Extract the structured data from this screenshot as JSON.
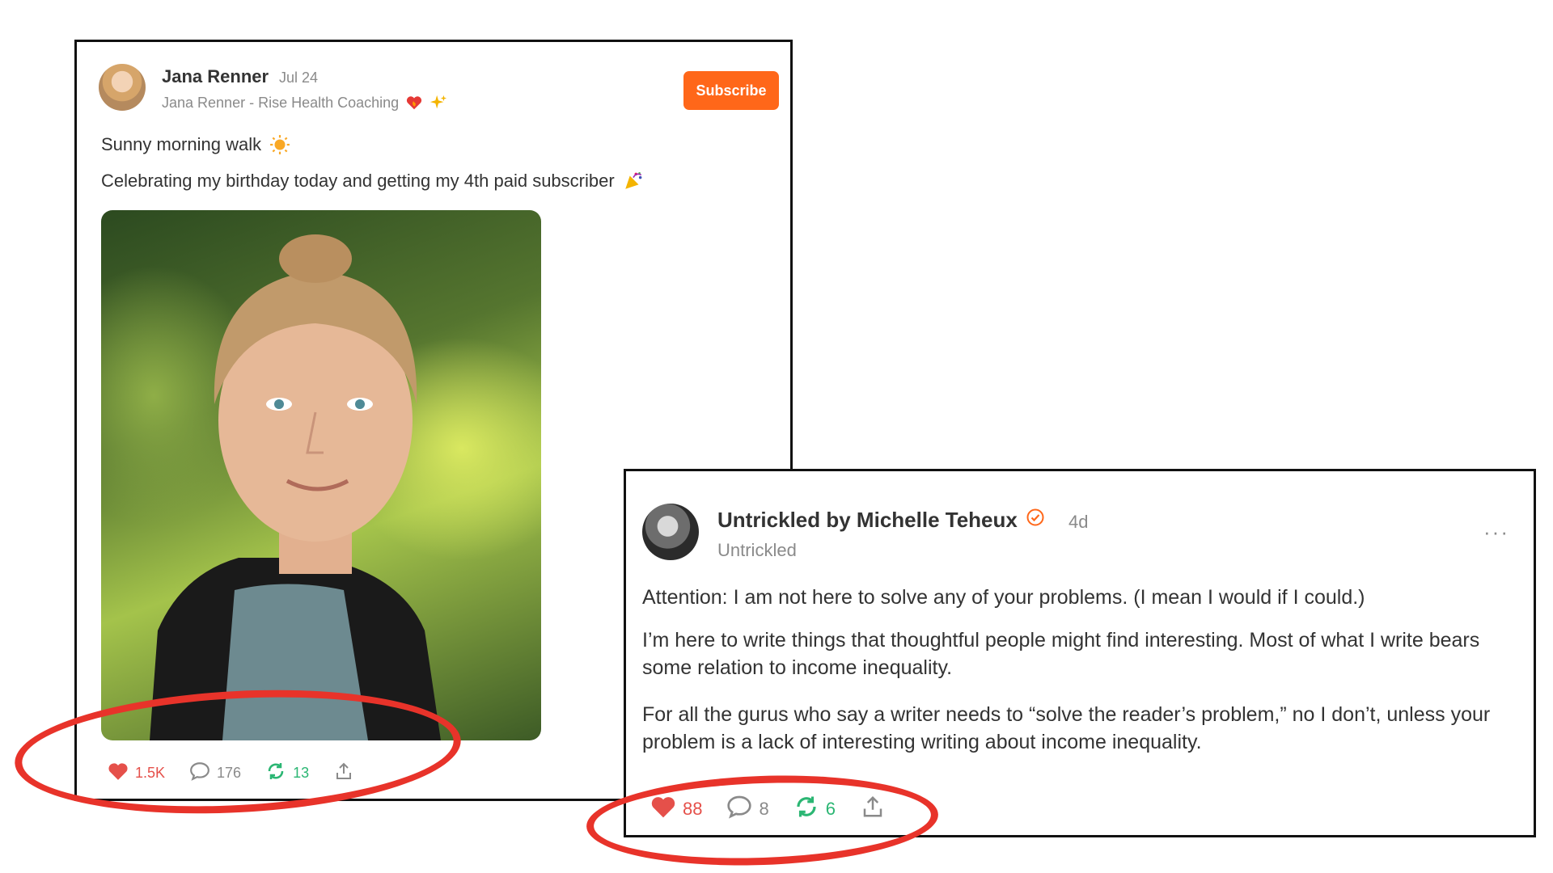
{
  "post1": {
    "author": "Jana Renner",
    "date": "Jul 24",
    "publication": "Jana Renner - Rise Health Coaching",
    "subscribe_label": "Subscribe",
    "line1": "Sunny morning walk",
    "line2": "Celebrating my birthday today and getting my 4th paid subscriber",
    "likes": "1.5K",
    "comments": "176",
    "restacks": "13"
  },
  "post2": {
    "author": "Untrickled by Michelle Teheux",
    "date": "4d",
    "publication": "Untrickled",
    "more": "···",
    "para1": "Attention: I am not here to solve any of your problems. (I mean I would if I could.)",
    "para2": "I’m here to write things that thoughtful people might find interesting. Most of what I write bears some relation to income inequality.",
    "para3": "For all the gurus who say a writer needs to “solve the reader’s problem,” no I don’t, unless your problem is a lack of interesting writing about income inequality.",
    "likes": "88",
    "comments": "8",
    "restacks": "6"
  },
  "colors": {
    "accent": "#ff6719",
    "like": "#e5504a",
    "restack": "#2bb673",
    "annotation": "#e8332a"
  },
  "icons": [
    "heart-icon",
    "comment-icon",
    "restack-icon",
    "share-icon",
    "verified-icon",
    "sun-icon",
    "party-icon"
  ]
}
